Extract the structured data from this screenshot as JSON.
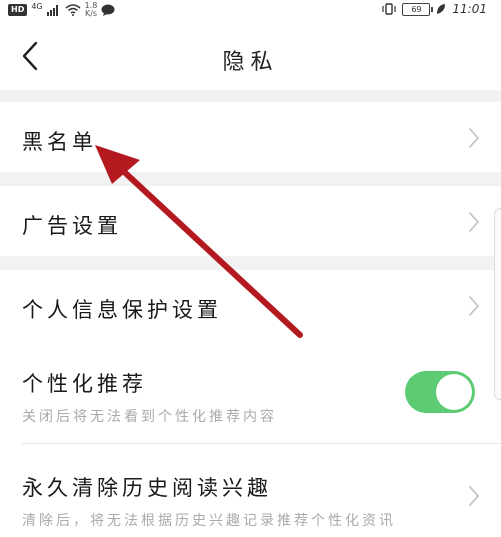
{
  "status_bar": {
    "hd": "HD",
    "network": "4G",
    "speed_value": "1.8",
    "speed_unit": "K/s",
    "battery": "69",
    "time": "11:01"
  },
  "header": {
    "title": "隐私"
  },
  "rows": {
    "blacklist": {
      "label": "黑名单"
    },
    "ad_settings": {
      "label": "广告设置"
    },
    "personal_info": {
      "label": "个人信息保护设置"
    },
    "personalized": {
      "label": "个性化推荐",
      "sub": "关闭后将无法看到个性化推荐内容",
      "toggle_on": true
    },
    "clear_history": {
      "label": "永久清除历史阅读兴趣",
      "sub": "清除后，将无法根据历史兴趣记录推荐个性化资讯"
    }
  },
  "icons": {
    "back": "chevron-left-icon",
    "row_arrow": "chevron-right-icon",
    "annotation": "red-arrow-annotation"
  },
  "colors": {
    "toggle_on": "#5ccb73",
    "annotation_arrow": "#b3191e",
    "background": "#f2f2f2"
  }
}
